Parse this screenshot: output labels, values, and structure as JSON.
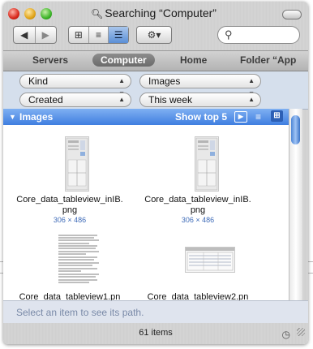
{
  "window": {
    "title": "Searching “Computer”",
    "status_text": "61 items",
    "path_hint": "Select an item to see its path."
  },
  "toolbar": {
    "back_glyph": "◀",
    "forward_glyph": "▶",
    "view_icon_glyph": "⊞",
    "view_list_glyph": "≡",
    "view_column_glyph": "☰",
    "action_glyph": "⚙▾",
    "search_placeholder": "",
    "search_glyph": "⚲"
  },
  "scope_tabs": [
    {
      "label": "Servers",
      "active": false
    },
    {
      "label": "Computer",
      "active": true
    },
    {
      "label": "Home",
      "active": false
    },
    {
      "label": "Folder “App",
      "active": false
    }
  ],
  "criteria": [
    {
      "attribute": "Kind",
      "value": "Images"
    },
    {
      "attribute": "Created",
      "value": "This week"
    }
  ],
  "section": {
    "disclosure": "▼",
    "name": "Images",
    "show_label": "Show top 5",
    "play_glyph": "▶",
    "list_glyph": "≡",
    "icon_glyph": "⊞"
  },
  "results": [
    {
      "name": "Core_data_tableview_inIB.\npng",
      "dims": "306 × 486"
    },
    {
      "name": "Core_data_tableview_inIB.\npng",
      "dims": "306 × 486"
    },
    {
      "name": "Core_data_tableview1.pn",
      "dims": ""
    },
    {
      "name": "Core_data_tableview2.pn",
      "dims": ""
    }
  ],
  "colors": {
    "section_blue": "#3f7ee0",
    "criteria_bg": "#d5dfec",
    "dims_text": "#3e6bb8"
  }
}
